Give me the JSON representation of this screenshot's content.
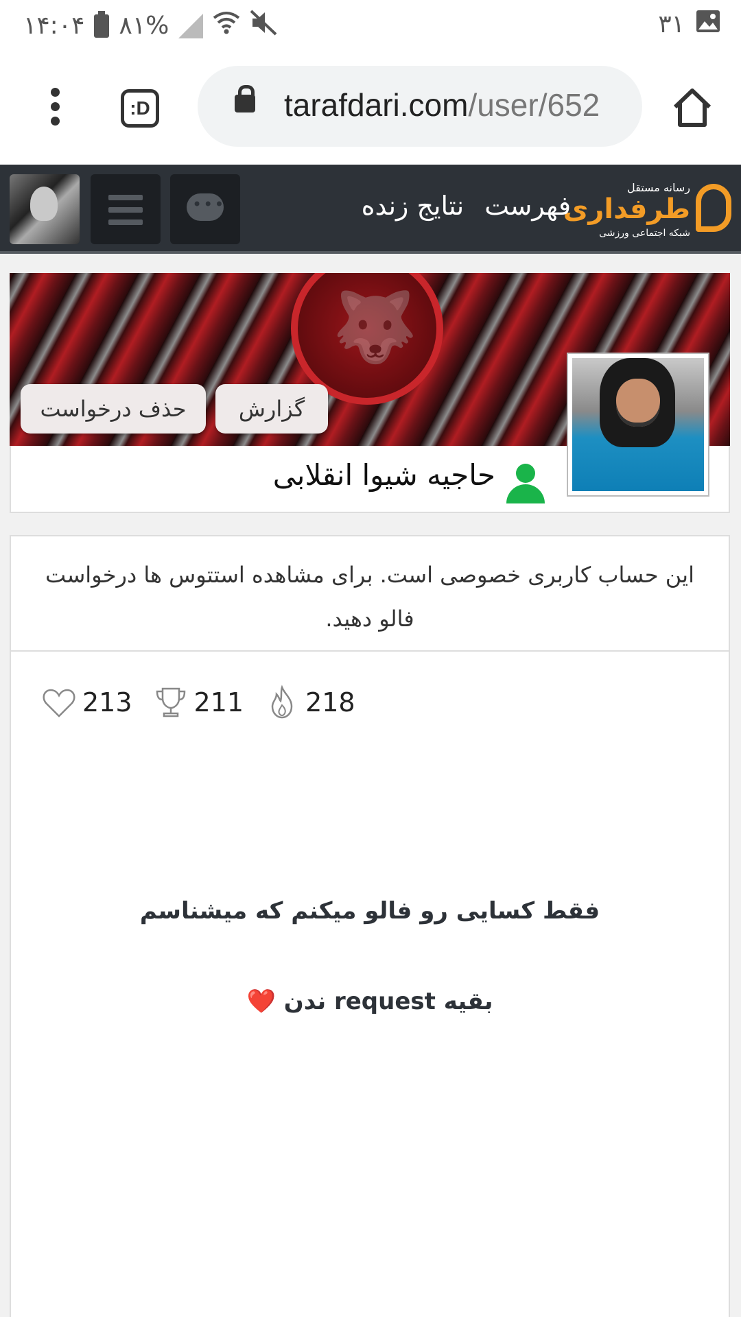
{
  "status_bar": {
    "time": "۱۴:۰۴",
    "battery": "۸۱%",
    "notification_count": "۳۱"
  },
  "browser": {
    "url_host": "tarafdari.com",
    "url_path": "/user/652",
    "tab_switcher_label": ":D"
  },
  "site_header": {
    "logo_top": "رسانه مستقل",
    "logo_main": "طرفداری",
    "logo_sub": "شبکه اجتماعی ورزشی",
    "nav_menu": "فهرست",
    "nav_live": "نتایج زنده"
  },
  "profile": {
    "name": "حاجیه شیوا انقلابی",
    "report_label": "گزارش",
    "delete_request_label": "حذف درخواست"
  },
  "content": {
    "private_message": "این حساب کاربری خصوصی است. برای مشاهده استتوس ها درخواست فالو دهید.",
    "stats": {
      "likes": "213",
      "trophies": "211",
      "fire": "218"
    },
    "bio_line1": "فقط کسایی رو فالو میکنم که میشناسم",
    "bio_line2": "بقیه request ندن",
    "bio_heart": "❤️"
  },
  "colors": {
    "header_bg": "#2d3238",
    "brand_orange": "#f39c26",
    "user_icon_green": "#1ab44a"
  }
}
